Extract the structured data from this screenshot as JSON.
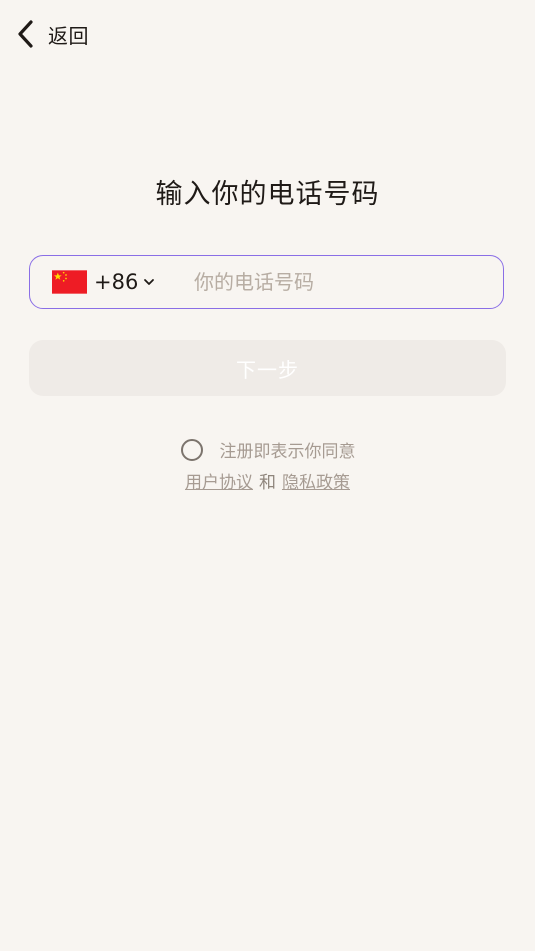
{
  "header": {
    "back_label": "返回",
    "back_icon": "chevron-left-icon"
  },
  "title": "输入你的电话号码",
  "phone": {
    "country_flag": "china-flag-icon",
    "dial_code": "+86",
    "placeholder": "你的电话号码",
    "value": ""
  },
  "next_button": {
    "label": "下一步"
  },
  "agreement": {
    "text": "注册即表示你同意",
    "user_agreement": "用户协议",
    "and": "和",
    "privacy_policy": "隐私政策"
  },
  "colors": {
    "background": "#F8F5F1",
    "input_border": "#8A6EE6",
    "button_disabled": "#EFEBE7",
    "muted_text": "#A69B92"
  }
}
